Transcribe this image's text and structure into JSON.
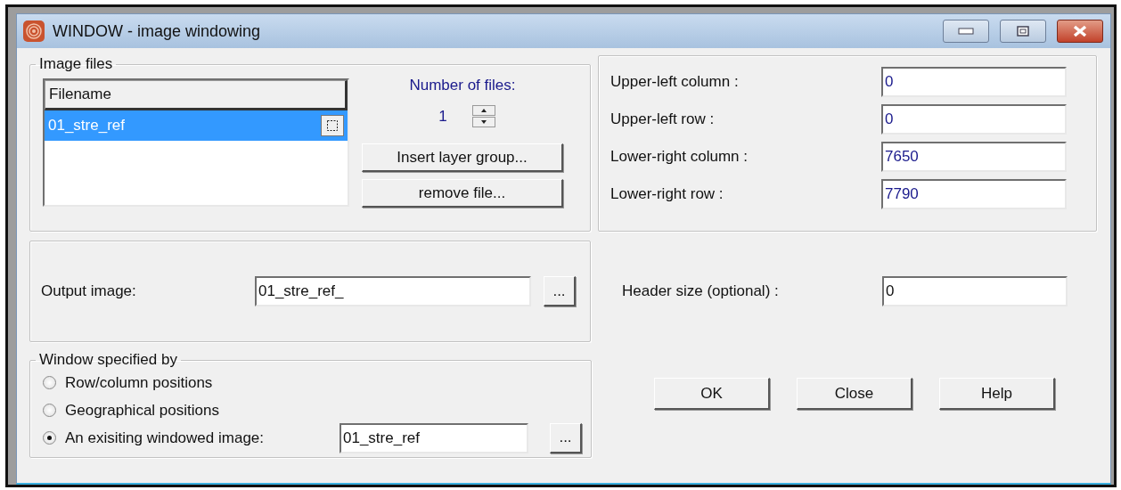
{
  "window": {
    "title": "WINDOW - image windowing"
  },
  "image_files": {
    "title": "Image files",
    "column": "Filename",
    "files": [
      {
        "name": "01_stre_ref",
        "selected": true
      }
    ],
    "count_label": "Number of files:",
    "count": "1",
    "buttons": [
      "Insert layer group...",
      "remove file..."
    ]
  },
  "coordinates": [
    {
      "label": "Upper-left column :",
      "value": "0"
    },
    {
      "label": "Upper-left row :",
      "value": "0"
    },
    {
      "label": "Lower-right column :",
      "value": "7650"
    },
    {
      "label": "Lower-right row :",
      "value": "7790"
    }
  ],
  "output": {
    "label": "Output image:",
    "value": "01_stre_ref_",
    "browse": "..."
  },
  "header": {
    "label": "Header size (optional) :",
    "value": "0"
  },
  "window_spec": {
    "title": "Window specified by",
    "options": [
      {
        "label": "Row/column positions",
        "selected": false
      },
      {
        "label": "Geographical positions",
        "selected": false
      },
      {
        "label": "An exisiting windowed image:",
        "selected": true
      }
    ],
    "windowed_image": "01_stre_ref",
    "browse": "..."
  },
  "buttons": [
    "OK",
    "Close",
    "Help"
  ]
}
